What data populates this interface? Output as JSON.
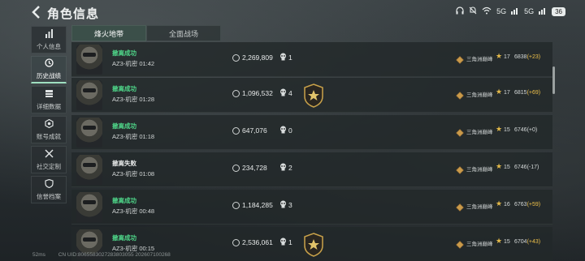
{
  "header": {
    "title": "角色信息",
    "back_icon": "chevron-left-icon"
  },
  "status_bar": {
    "network_a": "5G",
    "network_b": "5G",
    "battery": "36"
  },
  "sidebar": {
    "items": [
      {
        "label": "个人信息",
        "icon": "bar-chart-icon"
      },
      {
        "label": "历史战绩",
        "icon": "history-icon"
      },
      {
        "label": "详细数据",
        "icon": "stack-icon"
      },
      {
        "label": "账号成就",
        "icon": "medal-icon"
      },
      {
        "label": "社交定制",
        "icon": "tools-icon"
      },
      {
        "label": "信誉档案",
        "icon": "shield-icon"
      }
    ]
  },
  "tabs": [
    {
      "label": "烽火地带"
    },
    {
      "label": "全面战场"
    }
  ],
  "matches": [
    {
      "result": "撤离成功",
      "status": "win",
      "map": "AZ3-机密 01:42",
      "money": "2,269,809",
      "kills": "1",
      "badge": false,
      "rank_name": "三角洲巅峰",
      "level": "17",
      "score": "6838",
      "delta": "(+23)",
      "delta_type": "pos"
    },
    {
      "result": "撤离成功",
      "status": "win",
      "map": "AZ3-机密 01:28",
      "money": "1,096,532",
      "kills": "4",
      "badge": true,
      "rank_name": "三角洲巅峰",
      "level": "17",
      "score": "6815",
      "delta": "(+69)",
      "delta_type": "pos"
    },
    {
      "result": "撤离成功",
      "status": "win",
      "map": "AZ3-机密 01:18",
      "money": "647,076",
      "kills": "0",
      "badge": false,
      "rank_name": "三角洲巅峰",
      "level": "15",
      "score": "6746",
      "delta": "(+0)",
      "delta_type": "zero"
    },
    {
      "result": "撤离失败",
      "status": "lose",
      "map": "AZ3-机密 01:08",
      "money": "234,728",
      "kills": "2",
      "badge": false,
      "rank_name": "三角洲巅峰",
      "level": "15",
      "score": "6746",
      "delta": "(-17)",
      "delta_type": "neg"
    },
    {
      "result": "撤离成功",
      "status": "win",
      "map": "AZ3-机密 00:48",
      "money": "1,184,285",
      "kills": "3",
      "badge": false,
      "rank_name": "三角洲巅峰",
      "level": "16",
      "score": "6763",
      "delta": "(+59)",
      "delta_type": "pos"
    },
    {
      "result": "撤离成功",
      "status": "win",
      "map": "AZ3-机密 00:15",
      "money": "2,536,061",
      "kills": "1",
      "badge": true,
      "rank_name": "三角洲巅峰",
      "level": "15",
      "score": "6704",
      "delta": "(+43)",
      "delta_type": "pos"
    }
  ],
  "footer": {
    "ping": "52ms",
    "device_id": "CN UID:8065583027283803055 202607100268"
  },
  "colors": {
    "win": "#4fd88a",
    "lose": "#e6e8e8",
    "accent_tab": "#3b4f49",
    "delta_pos": "#f0c24a"
  }
}
